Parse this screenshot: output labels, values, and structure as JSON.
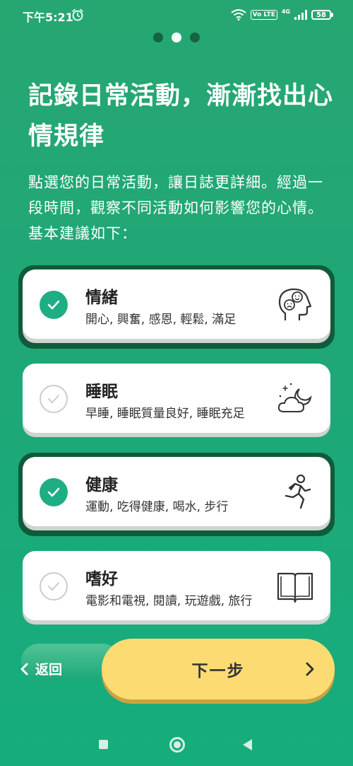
{
  "status_bar": {
    "time": "下午5:21",
    "volte": "Vo LTE",
    "network": "4G",
    "battery": "58"
  },
  "pager": {
    "count": 3,
    "active_index": 1
  },
  "title": "記錄日常活動，漸漸找出心情規律",
  "subtitle": "點選您的日常活動，讓日誌更詳細。經過一段時間，觀察不同活動如何影響您的心情。基本建議如下：",
  "categories": [
    {
      "title": "情緒",
      "description": "開心, 興奮, 感恩, 輕鬆, 滿足",
      "icon": "mood-face-icon",
      "selected": true
    },
    {
      "title": "睡眠",
      "description": "早睡, 睡眠質量良好, 睡眠充足",
      "icon": "moon-cloud-icon",
      "selected": false
    },
    {
      "title": "健康",
      "description": "運動, 吃得健康, 喝水, 步行",
      "icon": "running-person-icon",
      "selected": true
    },
    {
      "title": "嗜好",
      "description": "電影和電視, 閱讀, 玩遊戲, 旅行",
      "icon": "open-book-icon",
      "selected": false
    }
  ],
  "buttons": {
    "back_label": "返回",
    "next_label": "下一步"
  },
  "colors": {
    "background": "#1fa777",
    "accent_check": "#1fae83",
    "next_button": "#fcdc72",
    "selected_border": "#0f5b3a"
  }
}
